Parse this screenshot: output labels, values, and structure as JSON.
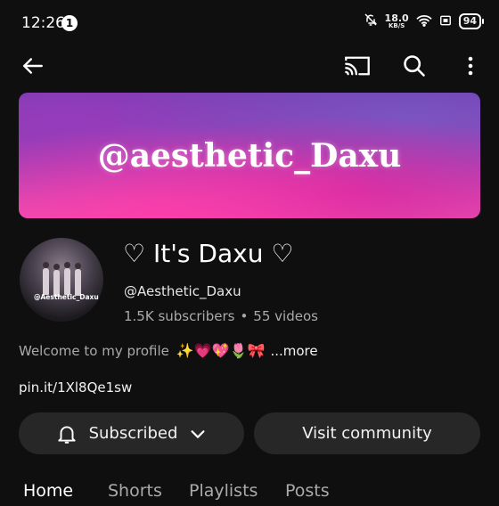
{
  "status_bar": {
    "time": "12:26",
    "notification_count": "1",
    "network_speed": "18.0",
    "network_unit": "KB/S",
    "battery": "94"
  },
  "top_bar": {
    "back_icon": "arrow-left-icon",
    "cast_icon": "cast-icon",
    "search_icon": "search-icon",
    "more_icon": "vertical-dots-icon"
  },
  "banner": {
    "text": "@aesthetic_Daxu"
  },
  "channel": {
    "avatar_watermark": "@Aesthetic_Daxu",
    "name": "♡ It's Daxu ♡",
    "handle": "@Aesthetic_Daxu",
    "subscribers": "1.5K subscribers",
    "separator": "•",
    "videos": "55 videos",
    "description": "Welcome to my profile",
    "description_emojis": "✨💗💖🌷🎀",
    "more_label": "...more",
    "link": "pin.it/1Xl8Qe1sw"
  },
  "actions": {
    "subscribed_label": "Subscribed",
    "community_label": "Visit community"
  },
  "tabs": [
    {
      "label": "Home",
      "active": true
    },
    {
      "label": "Shorts",
      "active": false
    },
    {
      "label": "Playlists",
      "active": false
    },
    {
      "label": "Posts",
      "active": false
    }
  ],
  "colors": {
    "background": "#0f0f0f",
    "button_bg": "#272727",
    "secondary_text": "#aaaaaa"
  }
}
